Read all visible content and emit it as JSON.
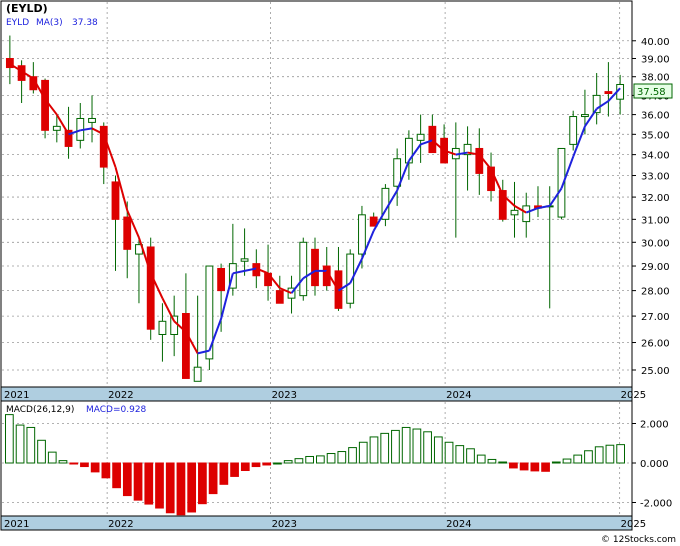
{
  "chart_data": [
    {
      "type": "candlestick",
      "title": "(EYLD)",
      "legend": {
        "symbol": "EYLD",
        "ma_label": "MA(3)",
        "ma_value": "37.38"
      },
      "last_price_label": "37.58",
      "y_axis": {
        "ticks": [
          "25.00",
          "26.00",
          "27.00",
          "28.00",
          "29.00",
          "30.00",
          "31.00",
          "32.00",
          "33.00",
          "34.00",
          "35.00",
          "36.00",
          "37.00",
          "38.00",
          "39.00",
          "40.00"
        ],
        "log_scale": true
      },
      "x_axis": {
        "ticks": [
          "2021",
          "2022",
          "2023",
          "2024",
          "2025"
        ]
      },
      "series": [
        {
          "name": "EYLD",
          "ohlc": [
            [
              39.0,
              40.3,
              37.6,
              38.5
            ],
            [
              38.6,
              38.9,
              36.6,
              37.8
            ],
            [
              38.0,
              38.8,
              37.1,
              37.3
            ],
            [
              37.8,
              37.9,
              34.8,
              35.2
            ],
            [
              35.2,
              36.0,
              34.6,
              35.4
            ],
            [
              35.2,
              36.4,
              33.8,
              34.4
            ],
            [
              34.7,
              36.6,
              34.3,
              35.8
            ],
            [
              35.6,
              37.0,
              34.6,
              35.8
            ],
            [
              35.4,
              35.6,
              32.6,
              33.4
            ],
            [
              32.7,
              33.0,
              28.8,
              31.0
            ],
            [
              31.1,
              31.8,
              28.5,
              29.7
            ],
            [
              29.5,
              30.2,
              27.5,
              29.9
            ],
            [
              29.8,
              30.2,
              26.1,
              26.5
            ],
            [
              26.3,
              27.5,
              25.3,
              26.8
            ],
            [
              26.3,
              27.8,
              25.5,
              27.0
            ],
            [
              27.1,
              28.7,
              25.7,
              24.7
            ],
            [
              24.6,
              27.8,
              24.6,
              25.1
            ],
            [
              25.4,
              29.0,
              25.0,
              29.0
            ],
            [
              28.9,
              29.1,
              26.4,
              28.0
            ],
            [
              28.1,
              30.8,
              27.8,
              29.1
            ],
            [
              29.2,
              30.6,
              28.6,
              29.3
            ],
            [
              29.1,
              29.7,
              28.1,
              28.6
            ],
            [
              28.7,
              29.9,
              27.6,
              28.2
            ],
            [
              28.0,
              28.6,
              27.5,
              27.5
            ],
            [
              27.7,
              28.6,
              27.1,
              28.1
            ],
            [
              27.8,
              30.2,
              27.6,
              30.0
            ],
            [
              29.7,
              30.2,
              27.8,
              28.2
            ],
            [
              29.0,
              29.8,
              28.0,
              28.2
            ],
            [
              28.8,
              29.8,
              27.2,
              27.3
            ],
            [
              27.5,
              29.7,
              27.3,
              29.5
            ],
            [
              29.5,
              31.6,
              28.9,
              31.2
            ],
            [
              31.1,
              31.3,
              30.7,
              30.7
            ],
            [
              31.0,
              32.6,
              30.7,
              32.4
            ],
            [
              32.5,
              34.3,
              31.6,
              33.8
            ],
            [
              33.6,
              35.2,
              32.8,
              34.8
            ],
            [
              34.7,
              36.0,
              33.6,
              35.0
            ],
            [
              35.4,
              36.0,
              34.6,
              34.1
            ],
            [
              34.8,
              35.5,
              34.0,
              33.6
            ],
            [
              33.8,
              35.6,
              30.2,
              34.3
            ],
            [
              34.0,
              35.4,
              32.3,
              34.5
            ],
            [
              34.3,
              35.3,
              32.1,
              33.1
            ],
            [
              33.4,
              34.1,
              31.8,
              32.3
            ],
            [
              32.3,
              32.8,
              30.9,
              31.0
            ],
            [
              31.2,
              32.7,
              30.2,
              31.4
            ],
            [
              30.9,
              32.2,
              30.2,
              31.6
            ],
            [
              31.6,
              32.5,
              31.1,
              31.5
            ],
            [
              31.6,
              32.5,
              27.3,
              31.6
            ],
            [
              31.1,
              33.3,
              31.0,
              34.3
            ],
            [
              34.5,
              36.2,
              34.2,
              35.9
            ],
            [
              35.9,
              37.3,
              35.0,
              36.0
            ],
            [
              36.1,
              38.2,
              35.5,
              37.0
            ],
            [
              37.2,
              38.8,
              35.9,
              37.1
            ],
            [
              36.8,
              38.1,
              36.0,
              37.58
            ]
          ]
        },
        {
          "name": "MA(3)",
          "color": "red/blue by trend",
          "values": [
            38.7,
            38.3,
            37.9,
            36.8,
            36.0,
            35.0,
            35.2,
            35.3,
            35.0,
            33.4,
            31.4,
            30.2,
            28.7,
            27.7,
            26.8,
            26.4,
            25.6,
            25.7,
            26.9,
            28.7,
            28.8,
            28.9,
            28.7,
            28.1,
            27.9,
            28.5,
            28.8,
            28.8,
            28.0,
            28.3,
            29.3,
            30.5,
            31.4,
            32.3,
            33.7,
            34.5,
            34.7,
            34.2,
            34.0,
            34.1,
            34.0,
            33.3,
            32.1,
            31.6,
            31.3,
            31.5,
            31.6,
            32.4,
            33.9,
            35.4,
            36.3,
            36.7,
            37.38
          ]
        }
      ]
    },
    {
      "type": "bar",
      "title": "MACD(26,12,9)",
      "legend": {
        "label": "MACD(26,12,9)",
        "value_label": "MACD=0.928"
      },
      "y_axis": {
        "ticks": [
          "2.000",
          "0.000",
          "-2.000"
        ],
        "range": [
          -2.6,
          2.6
        ]
      },
      "x_axis": {
        "ticks": [
          "2021",
          "2022",
          "2023",
          "2024",
          "2025"
        ]
      },
      "values": [
        2.45,
        1.92,
        1.8,
        1.15,
        0.55,
        0.12,
        -0.05,
        -0.18,
        -0.45,
        -0.75,
        -1.25,
        -1.65,
        -1.88,
        -2.08,
        -2.28,
        -2.52,
        -2.62,
        -2.48,
        -2.06,
        -1.55,
        -1.08,
        -0.68,
        -0.38,
        -0.18,
        -0.1,
        0.0,
        0.12,
        0.22,
        0.33,
        0.36,
        0.48,
        0.58,
        0.78,
        1.05,
        1.32,
        1.5,
        1.65,
        1.8,
        1.72,
        1.58,
        1.32,
        1.05,
        0.88,
        0.72,
        0.4,
        0.18,
        0.05,
        -0.25,
        -0.35,
        -0.4,
        -0.42,
        0.05,
        0.2,
        0.4,
        0.62,
        0.82,
        0.9,
        0.93
      ]
    }
  ],
  "footer": "© 12Stocks.com",
  "colors": {
    "up_candle": "#ffffff",
    "down_candle": "#dd0000",
    "candle_outline": "#006600",
    "ma_up": "#1e22dd",
    "ma_down": "#dd0000",
    "macd_positive": "#ffffff",
    "macd_negative": "#dd0000",
    "axis_strip": "#afcee0",
    "price_label_bg": "#e6ffe6",
    "price_label_text": "#006600"
  }
}
